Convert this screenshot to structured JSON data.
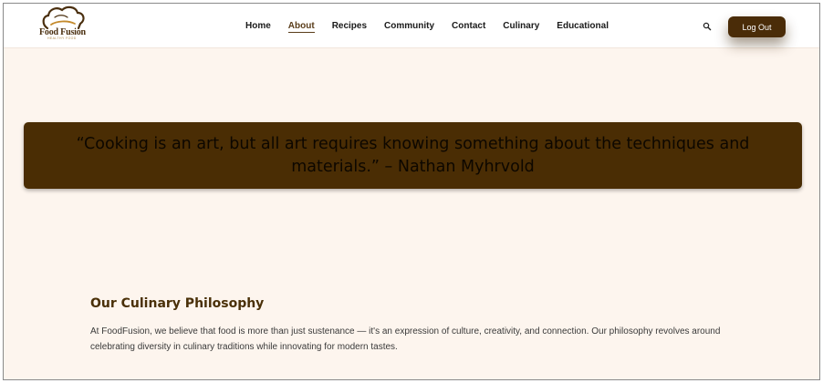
{
  "brand": {
    "name": "Food Fusion",
    "tagline": "HEALTHY FOOD"
  },
  "nav": {
    "items": [
      {
        "label": "Home"
      },
      {
        "label": "About",
        "active": true
      },
      {
        "label": "Recipes"
      },
      {
        "label": "Community"
      },
      {
        "label": "Contact"
      },
      {
        "label": "Culinary"
      },
      {
        "label": "Educational"
      }
    ],
    "search_icon": "search-icon",
    "logout_label": "Log Out"
  },
  "quote": {
    "text": "“Cooking is an art, but all art requires knowing something about the techniques and materials.” – Nathan Myhrvold"
  },
  "philosophy": {
    "title": "Our Culinary Philosophy",
    "body": "At FoodFusion, we believe that food is more than just sustenance — it's an expression of culture, creativity, and connection. Our philosophy revolves around celebrating diversity in culinary traditions while innovating for modern tastes."
  },
  "colors": {
    "accent": "#4a2c08",
    "banner": "#4a2d04",
    "page_background": "#fdf5ee"
  }
}
